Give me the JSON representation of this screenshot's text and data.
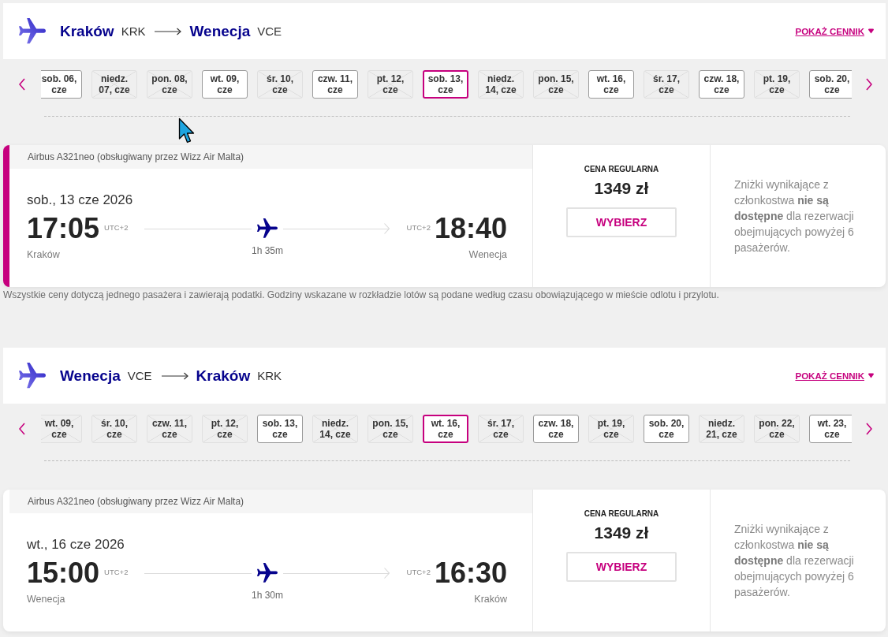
{
  "journeys": [
    {
      "origin": {
        "city": "Kraków",
        "code": "KRK"
      },
      "destination": {
        "city": "Wenecja",
        "code": "VCE"
      },
      "price_link": "POKAŻ CENNIK",
      "dates": [
        {
          "label": "sob. 06, cze",
          "available": true,
          "selected": false
        },
        {
          "label": "niedz. 07, cze",
          "available": false,
          "selected": false
        },
        {
          "label": "pon. 08, cze",
          "available": false,
          "selected": false
        },
        {
          "label": "wt. 09, cze",
          "available": true,
          "selected": false
        },
        {
          "label": "śr. 10, cze",
          "available": false,
          "selected": false
        },
        {
          "label": "czw. 11, cze",
          "available": true,
          "selected": false
        },
        {
          "label": "pt. 12, cze",
          "available": false,
          "selected": false
        },
        {
          "label": "sob. 13, cze",
          "available": true,
          "selected": true
        },
        {
          "label": "niedz. 14, cze",
          "available": false,
          "selected": false
        },
        {
          "label": "pon. 15, cze",
          "available": false,
          "selected": false
        },
        {
          "label": "wt. 16, cze",
          "available": true,
          "selected": false
        },
        {
          "label": "śr. 17, cze",
          "available": false,
          "selected": false
        },
        {
          "label": "czw. 18, cze",
          "available": true,
          "selected": false
        },
        {
          "label": "pt. 19, cze",
          "available": false,
          "selected": false
        },
        {
          "label": "sob. 20, cze",
          "available": true,
          "selected": false
        }
      ],
      "flight": {
        "selected": true,
        "aircraft": "Airbus A321neo (obsługiwany przez Wizz Air Malta)",
        "date": "sob., 13 cze 2026",
        "departure": {
          "time": "17:05",
          "timezone": "UTC+2",
          "city": "Kraków"
        },
        "duration": "1h 35m",
        "arrival": {
          "time": "18:40",
          "timezone": "UTC+2",
          "city": "Wenecja"
        },
        "fare_label": "CENA REGULARNA",
        "price": "1349 zł",
        "select_button": "WYBIERZ",
        "note": "Zniżki wynikające z członkostwa **nie są dostępne** dla rezerwacji obejmujących powyżej 6 pasażerów."
      },
      "footnote": "Wszystkie ceny dotyczą jednego pasażera i zawierają podatki. Godziny wskazane w rozkładzie lotów są podane według czasu obowiązującego w mieście odlotu i przylotu."
    },
    {
      "origin": {
        "city": "Wenecja",
        "code": "VCE"
      },
      "destination": {
        "city": "Kraków",
        "code": "KRK"
      },
      "price_link": "POKAŻ CENNIK",
      "dates": [
        {
          "label": "wt. 09, cze",
          "available": false,
          "selected": false
        },
        {
          "label": "śr. 10, cze",
          "available": false,
          "selected": false
        },
        {
          "label": "czw. 11, cze",
          "available": false,
          "selected": false
        },
        {
          "label": "pt. 12, cze",
          "available": false,
          "selected": false
        },
        {
          "label": "sob. 13, cze",
          "available": true,
          "selected": false
        },
        {
          "label": "niedz. 14, cze",
          "available": false,
          "selected": false
        },
        {
          "label": "pon. 15, cze",
          "available": false,
          "selected": false
        },
        {
          "label": "wt. 16, cze",
          "available": true,
          "selected": true
        },
        {
          "label": "śr. 17, cze",
          "available": false,
          "selected": false
        },
        {
          "label": "czw. 18, cze",
          "available": true,
          "selected": false
        },
        {
          "label": "pt. 19, cze",
          "available": false,
          "selected": false
        },
        {
          "label": "sob. 20, cze",
          "available": true,
          "selected": false
        },
        {
          "label": "niedz. 21, cze",
          "available": false,
          "selected": false
        },
        {
          "label": "pon. 22, cze",
          "available": false,
          "selected": false
        },
        {
          "label": "wt. 23, cze",
          "available": true,
          "selected": false
        }
      ],
      "flight": {
        "selected": false,
        "aircraft": "Airbus A321neo (obsługiwany przez Wizz Air Malta)",
        "date": "wt., 16 cze 2026",
        "departure": {
          "time": "15:00",
          "timezone": "UTC+2",
          "city": "Wenecja"
        },
        "duration": "1h 30m",
        "arrival": {
          "time": "16:30",
          "timezone": "UTC+2",
          "city": "Kraków"
        },
        "fare_label": "CENA REGULARNA",
        "price": "1349 zł",
        "select_button": "WYBIERZ",
        "note": "Zniżki wynikające z członkostwa **nie są dostępne** dla rezerwacji obejmujących powyżej 6 pasażerów."
      }
    }
  ]
}
